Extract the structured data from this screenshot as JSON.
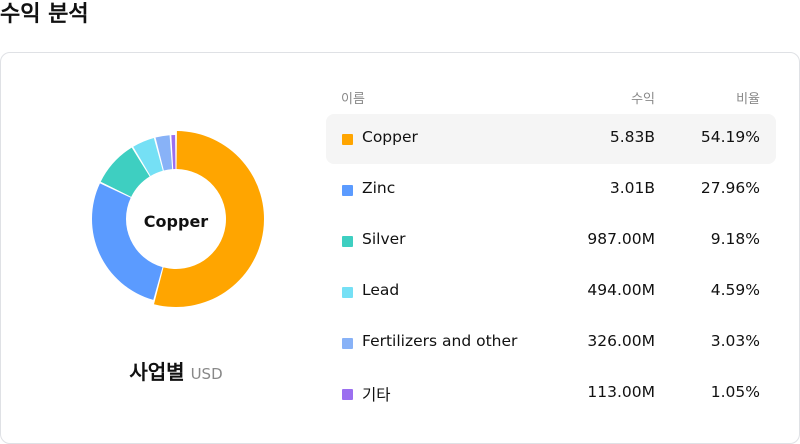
{
  "page_title": "수익 분석",
  "center_label": "Copper",
  "caption": {
    "main": "사업별",
    "unit": "USD"
  },
  "table": {
    "headers": {
      "name": "이름",
      "revenue": "수익",
      "share": "비율"
    },
    "rows": [
      {
        "name": "Copper",
        "revenue": "5.83B",
        "share": "54.19%",
        "color": "#ffa500"
      },
      {
        "name": "Zinc",
        "revenue": "3.01B",
        "share": "27.96%",
        "color": "#5b9bff"
      },
      {
        "name": "Silver",
        "revenue": "987.00M",
        "share": "9.18%",
        "color": "#3ecfc1"
      },
      {
        "name": "Lead",
        "revenue": "494.00M",
        "share": "4.59%",
        "color": "#75e0f5"
      },
      {
        "name": "Fertilizers and other",
        "revenue": "326.00M",
        "share": "3.03%",
        "color": "#88b2f7"
      },
      {
        "name": "기타",
        "revenue": "113.00M",
        "share": "1.05%",
        "color": "#9b6ff0"
      }
    ]
  },
  "chart_data": {
    "type": "pie",
    "categories": [
      "Copper",
      "Zinc",
      "Silver",
      "Lead",
      "Fertilizers and other",
      "기타"
    ],
    "values": [
      54.19,
      27.96,
      9.18,
      4.59,
      3.03,
      1.05
    ],
    "colors": [
      "#ffa500",
      "#5b9bff",
      "#3ecfc1",
      "#75e0f5",
      "#88b2f7",
      "#9b6ff0"
    ],
    "highlighted": "Copper"
  }
}
